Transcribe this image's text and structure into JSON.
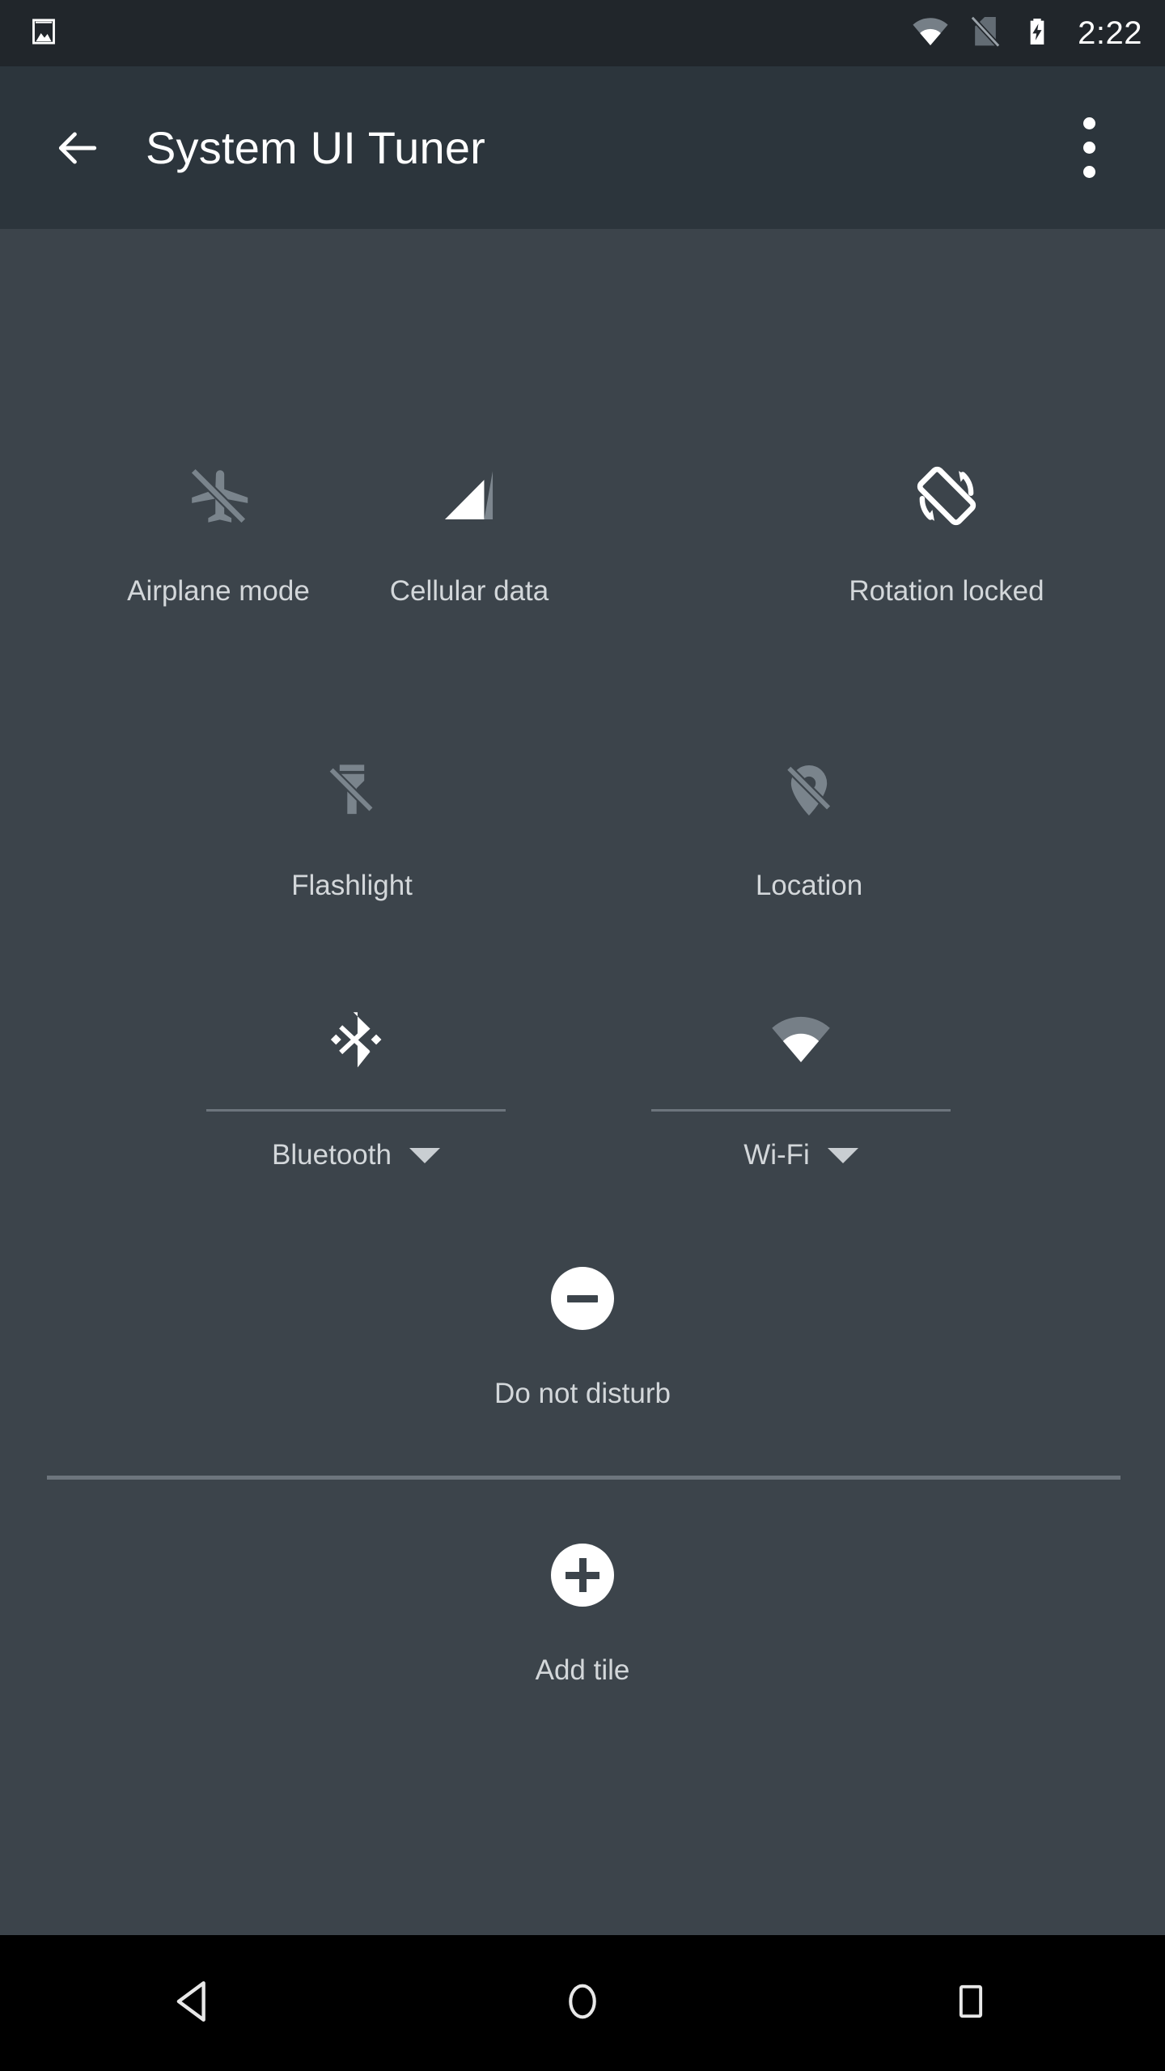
{
  "status_bar": {
    "left_icons": [
      {
        "name": "image-notification-icon",
        "label": "Image"
      }
    ],
    "right_icons": [
      {
        "name": "wifi-signal-icon",
        "label": "Wi-Fi signal"
      },
      {
        "name": "no-sim-icon",
        "label": "No SIM card"
      },
      {
        "name": "battery-charging-icon",
        "label": "Battery charging"
      }
    ],
    "time": "2:22"
  },
  "app_bar": {
    "back_label": "Navigate up",
    "title": "System UI Tuner",
    "overflow_label": "More options"
  },
  "quick_settings": {
    "tiles": [
      {
        "id": "airplane-mode",
        "label": "Airplane mode",
        "icon": "airplane-off-icon",
        "state": "off",
        "icon_color": "#7a848c",
        "has_dropdown": false,
        "has_divider": false
      },
      {
        "id": "cellular-data",
        "label": "Cellular data",
        "icon": "cellular-signal-icon",
        "state": "on",
        "icon_color": "#ffffff",
        "has_dropdown": false,
        "has_divider": false
      },
      {
        "id": "rotation-locked",
        "label": "Rotation locked",
        "icon": "screen-rotation-icon",
        "state": "on",
        "icon_color": "#ffffff",
        "has_dropdown": false,
        "has_divider": false
      },
      {
        "id": "flashlight",
        "label": "Flashlight",
        "icon": "flashlight-off-icon",
        "state": "off",
        "icon_color": "#7a848c",
        "has_dropdown": false,
        "has_divider": false
      },
      {
        "id": "location",
        "label": "Location",
        "icon": "location-off-icon",
        "state": "off",
        "icon_color": "#7a848c",
        "has_dropdown": false,
        "has_divider": false
      },
      {
        "id": "bluetooth",
        "label": "Bluetooth",
        "icon": "bluetooth-icon",
        "state": "on",
        "icon_color": "#ffffff",
        "has_dropdown": true,
        "has_divider": true
      },
      {
        "id": "wifi",
        "label": "Wi-Fi",
        "icon": "wifi-icon",
        "state": "on",
        "icon_color": "#ffffff",
        "has_dropdown": true,
        "has_divider": true
      },
      {
        "id": "do-not-disturb",
        "label": "Do not disturb",
        "icon": "do-not-disturb-icon",
        "state": "on",
        "icon_color": "#ffffff",
        "has_dropdown": false,
        "has_divider": false
      }
    ],
    "add_tile": {
      "label": "Add tile",
      "icon": "add-plus-icon"
    }
  },
  "nav_bar": {
    "buttons": [
      {
        "id": "back",
        "label": "Back",
        "icon": "nav-back-icon"
      },
      {
        "id": "home",
        "label": "Home",
        "icon": "nav-home-icon"
      },
      {
        "id": "recents",
        "label": "Recent apps",
        "icon": "nav-recents-icon"
      }
    ]
  },
  "theme": {
    "status_bar_bg": "#21262b",
    "app_bar_bg": "#2c353c",
    "content_bg": "#3c444b",
    "nav_bar_bg": "#000000",
    "icon_on": "#ffffff",
    "icon_off": "#7a848c",
    "label_color": "#d3d7da",
    "divider_color": "#6d757d"
  }
}
